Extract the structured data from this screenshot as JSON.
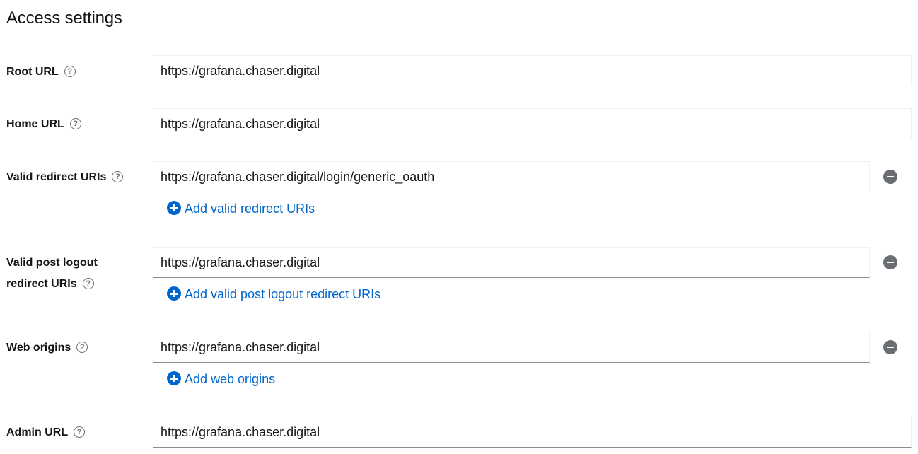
{
  "section": {
    "title": "Access settings"
  },
  "root_url": {
    "label": "Root URL",
    "value": "https://grafana.chaser.digital"
  },
  "home_url": {
    "label": "Home URL",
    "value": "https://grafana.chaser.digital"
  },
  "valid_redirect": {
    "label": "Valid redirect URIs",
    "value": "https://grafana.chaser.digital/login/generic_oauth",
    "add_label": "Add valid redirect URIs"
  },
  "post_logout": {
    "label_line1": "Valid post logout",
    "label_line2": "redirect URIs",
    "value": "https://grafana.chaser.digital",
    "add_label": "Add valid post logout redirect URIs"
  },
  "web_origins": {
    "label": "Web origins",
    "value": "https://grafana.chaser.digital",
    "add_label": "Add web origins"
  },
  "admin_url": {
    "label": "Admin URL",
    "value": "https://grafana.chaser.digital"
  },
  "icons": {
    "help": "help-circle-icon",
    "remove": "minus-circle-icon",
    "add": "plus-circle-icon"
  },
  "colors": {
    "link": "#0066cc",
    "icon_gray": "#6a6e73",
    "border": "#8a8d90"
  }
}
